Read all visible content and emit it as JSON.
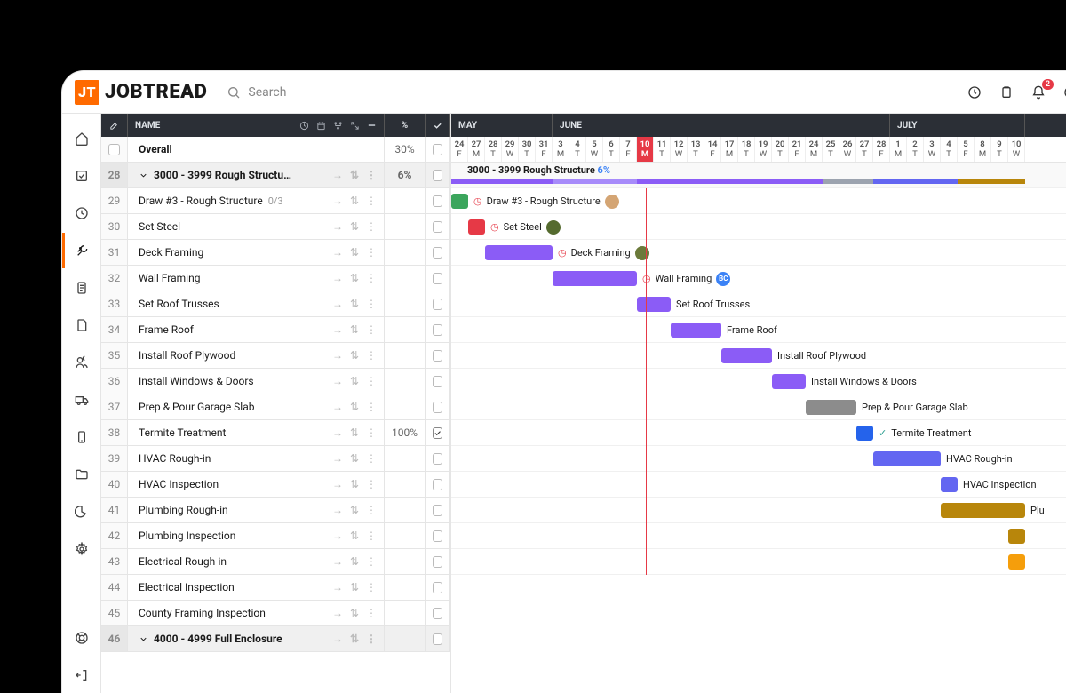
{
  "app": {
    "name": "JOBTREAD",
    "search_placeholder": "Search"
  },
  "notifications": {
    "count": "2"
  },
  "colhead": {
    "name": "NAME",
    "pct": "%"
  },
  "overall": {
    "label": "Overall",
    "pct": "30%"
  },
  "months": [
    "MAY",
    "JUNE",
    "JULY"
  ],
  "days": [
    {
      "n": "24",
      "w": "F"
    },
    {
      "n": "27",
      "w": "M"
    },
    {
      "n": "28",
      "w": "T"
    },
    {
      "n": "29",
      "w": "W"
    },
    {
      "n": "30",
      "w": "T"
    },
    {
      "n": "31",
      "w": "F"
    },
    {
      "n": "3",
      "w": "M"
    },
    {
      "n": "4",
      "w": "T"
    },
    {
      "n": "5",
      "w": "W"
    },
    {
      "n": "6",
      "w": "T"
    },
    {
      "n": "7",
      "w": "F"
    },
    {
      "n": "10",
      "w": "M",
      "today": true
    },
    {
      "n": "11",
      "w": "T"
    },
    {
      "n": "12",
      "w": "W"
    },
    {
      "n": "13",
      "w": "T"
    },
    {
      "n": "14",
      "w": "F"
    },
    {
      "n": "17",
      "w": "M"
    },
    {
      "n": "18",
      "w": "T"
    },
    {
      "n": "19",
      "w": "W"
    },
    {
      "n": "20",
      "w": "T"
    },
    {
      "n": "21",
      "w": "F"
    },
    {
      "n": "24",
      "w": "M"
    },
    {
      "n": "25",
      "w": "T"
    },
    {
      "n": "26",
      "w": "W"
    },
    {
      "n": "27",
      "w": "T"
    },
    {
      "n": "28",
      "w": "F"
    },
    {
      "n": "1",
      "w": "M"
    },
    {
      "n": "2",
      "w": "T"
    },
    {
      "n": "3",
      "w": "W"
    },
    {
      "n": "4",
      "w": "T"
    },
    {
      "n": "5",
      "w": "F"
    },
    {
      "n": "8",
      "w": "M"
    },
    {
      "n": "9",
      "w": "T"
    },
    {
      "n": "10",
      "w": "W"
    }
  ],
  "group1": {
    "label": "3000 - 3999 Rough Structure",
    "pct_text": "6%",
    "row_num": "28",
    "pct_col": "6%"
  },
  "rows": [
    {
      "num": "29",
      "name": "Draw #3 - Rough Structure",
      "sub": "0/3"
    },
    {
      "num": "30",
      "name": "Set Steel"
    },
    {
      "num": "31",
      "name": "Deck Framing"
    },
    {
      "num": "32",
      "name": "Wall Framing"
    },
    {
      "num": "33",
      "name": "Set Roof Trusses"
    },
    {
      "num": "34",
      "name": "Frame Roof"
    },
    {
      "num": "35",
      "name": "Install Roof Plywood"
    },
    {
      "num": "36",
      "name": "Install Windows & Doors"
    },
    {
      "num": "37",
      "name": "Prep & Pour Garage Slab"
    },
    {
      "num": "38",
      "name": "Termite Treatment",
      "pct": "100%",
      "done": true
    },
    {
      "num": "39",
      "name": "HVAC Rough-in"
    },
    {
      "num": "40",
      "name": "HVAC Inspection"
    },
    {
      "num": "41",
      "name": "Plumbing Rough-in"
    },
    {
      "num": "42",
      "name": "Plumbing Inspection"
    },
    {
      "num": "43",
      "name": "Electrical Rough-in"
    },
    {
      "num": "44",
      "name": "Electrical Inspection"
    },
    {
      "num": "45",
      "name": "County Framing Inspection"
    }
  ],
  "group2": {
    "label": "4000 - 4999 Full Enclosure",
    "row_num": "46"
  },
  "bars": [
    {
      "label": "Draw #3 - Rough Structure",
      "start": 0,
      "len": 1,
      "color": "#3ba55c",
      "clock": true,
      "avatar": "#d4a574"
    },
    {
      "label": "Set Steel",
      "start": 1,
      "len": 1,
      "color": "#e63946",
      "clock": true,
      "avatar": "#556b2f"
    },
    {
      "label": "Deck Framing",
      "start": 2,
      "len": 4,
      "color": "#8b5cf6",
      "clock": true,
      "avatar": "#6b7a3a"
    },
    {
      "label": "Wall Framing",
      "start": 6,
      "len": 5,
      "color": "#8b5cf6",
      "clock": true,
      "avatar": "#3b82f6",
      "avatar_text": "BC"
    },
    {
      "label": "Set Roof Trusses",
      "start": 11,
      "len": 2,
      "color": "#8b5cf6"
    },
    {
      "label": "Frame Roof",
      "start": 13,
      "len": 3,
      "color": "#8b5cf6"
    },
    {
      "label": "Install Roof Plywood",
      "start": 16,
      "len": 3,
      "color": "#8b5cf6"
    },
    {
      "label": "Install Windows & Doors",
      "start": 19,
      "len": 2,
      "color": "#8b5cf6"
    },
    {
      "label": "Prep & Pour Garage Slab",
      "start": 21,
      "len": 3,
      "color": "#8c8c8c"
    },
    {
      "label": "Termite Treatment",
      "start": 24,
      "len": 1,
      "color": "#2563eb",
      "check": true
    },
    {
      "label": "HVAC Rough-in",
      "start": 25,
      "len": 4,
      "color": "#6366f1"
    },
    {
      "label": "HVAC Inspection",
      "start": 29,
      "len": 1,
      "color": "#6366f1"
    },
    {
      "label": "Plumbing Rough-in",
      "start": 29,
      "len": 5,
      "color": "#b8860b",
      "truncate": "Plu"
    },
    {
      "label": "",
      "start": 33,
      "len": 1,
      "color": "#b8860b"
    },
    {
      "label": "",
      "start": 33,
      "len": 1,
      "color": "#f59e0b"
    }
  ],
  "stripes": [
    {
      "start": 0,
      "len": 6,
      "color": "#8b5cf6"
    },
    {
      "start": 6,
      "len": 5,
      "color": "#a78bfa"
    },
    {
      "start": 11,
      "len": 11,
      "color": "#8b5cf6"
    },
    {
      "start": 22,
      "len": 3,
      "color": "#9ca3af"
    },
    {
      "start": 25,
      "len": 5,
      "color": "#6366f1"
    },
    {
      "start": 30,
      "len": 4,
      "color": "#b8860b"
    }
  ]
}
